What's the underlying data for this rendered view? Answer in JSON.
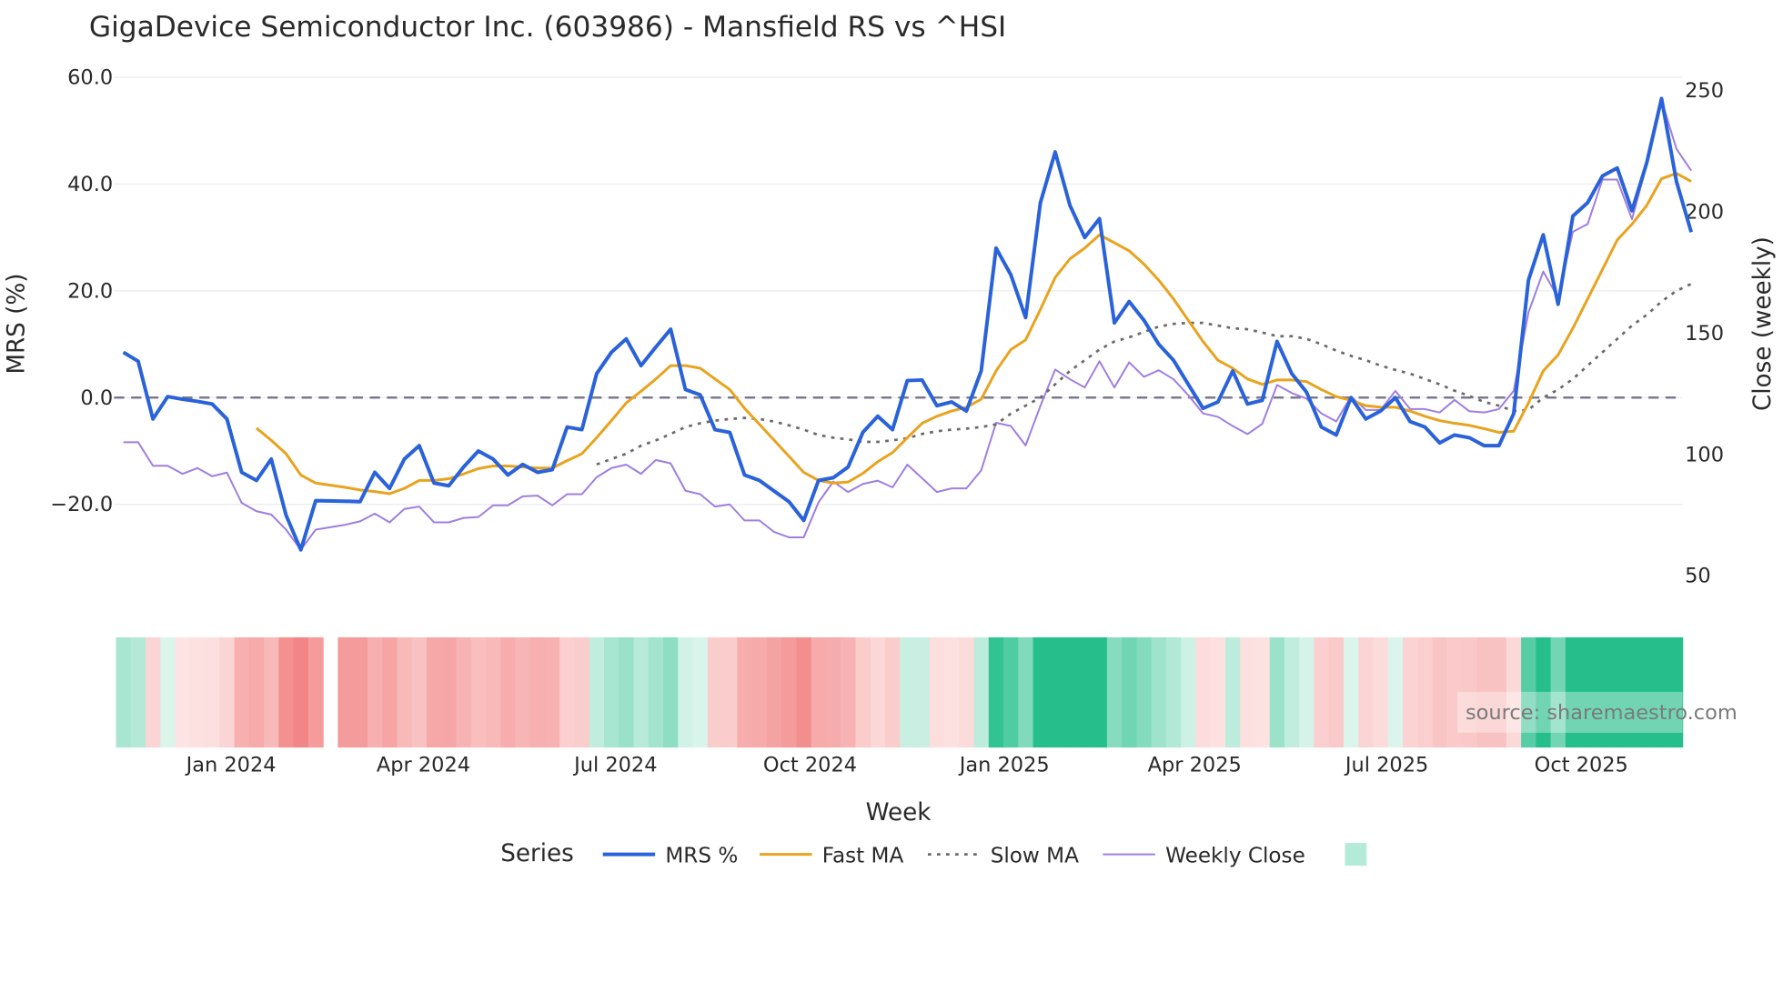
{
  "chart_data": {
    "type": "line",
    "title": "GigaDevice Semiconductor Inc. (603986) - Mansfield RS vs ^HSI",
    "xlabel": "Week",
    "ylabel": "MRS (%)",
    "y2label": "Close (weekly)",
    "ylim": [
      -31,
      62
    ],
    "y2lim": [
      50,
      258
    ],
    "yticks": [
      "60.0",
      "40.0",
      "20.0",
      "0.0",
      "−20.0"
    ],
    "ytick_values": [
      60,
      40,
      20,
      0,
      -20
    ],
    "y2ticks": [
      "250",
      "200",
      "150",
      "100",
      "50"
    ],
    "y2tick_values": [
      250,
      200,
      150,
      100,
      50
    ],
    "xticks": [
      "Jan 2024",
      "Apr 2024",
      "Jul 2024",
      "Oct 2024",
      "Jan 2025",
      "Apr 2025",
      "Jul 2025",
      "Oct 2025"
    ],
    "xtick_dates": [
      "2024-01-01",
      "2024-04-01",
      "2024-07-01",
      "2024-10-01",
      "2025-01-01",
      "2025-04-01",
      "2025-07-01",
      "2025-10-01"
    ],
    "x_start": "2023-11-11",
    "x_frequency": "weekly",
    "missing_week_index": 14,
    "zero_line": 0,
    "grid": true,
    "legend_title": "Series",
    "legend_position": "bottom",
    "series": [
      {
        "name": "MRS %",
        "axis": "left",
        "color": "#2a62d9",
        "values": [
          8.5,
          6.8,
          -4,
          0.2,
          -0.3,
          -0.7,
          -1.2,
          -4,
          -14,
          -15.5,
          -11.5,
          -22,
          -28.5,
          -19.3,
          -19.4,
          -19.5,
          -14,
          -17,
          -11.5,
          -9,
          -16,
          -16.5,
          -13,
          -10,
          -11.5,
          -14.5,
          -12.5,
          -14,
          -13.5,
          -5.5,
          -6,
          4.5,
          8.5,
          11,
          6,
          9.5,
          12.8,
          1.5,
          0.5,
          -6,
          -6.5,
          -14.5,
          -15.5,
          -17.5,
          -19.5,
          -23,
          -15.5,
          -15,
          -13,
          -6.5,
          -3.5,
          -6,
          3.2,
          3.3,
          -1.5,
          -0.8,
          -2.5,
          5,
          28,
          23,
          15,
          36.5,
          46,
          36,
          30,
          33.5,
          14,
          18,
          14.5,
          10,
          7,
          2.5,
          -2,
          -0.8,
          5,
          -1.2,
          -0.5,
          10.5,
          4.5,
          1,
          -5.5,
          -7,
          0,
          -4,
          -2.5,
          0,
          -4.5,
          -5.5,
          -8.5,
          -7,
          -7.5,
          -9,
          -9,
          -3,
          22,
          30.5,
          17.5,
          34,
          36.5,
          41.5,
          43,
          35,
          44,
          56,
          40.5,
          31
        ]
      },
      {
        "name": "Fast MA",
        "axis": "left",
        "color": "#e8a31f",
        "values": [
          -5.7,
          -8,
          -10.5,
          -14.5,
          -16,
          -16.8,
          -17.3,
          -17.6,
          -18,
          -17,
          -15.5,
          -15.5,
          -15.2,
          -14.3,
          -13.3,
          -12.8,
          -12.8,
          -13,
          -13.2,
          -13.2,
          -11.8,
          -10.5,
          -7.5,
          -4.3,
          -1,
          1.2,
          3.5,
          6,
          6,
          5.5,
          3.5,
          1.5,
          -2,
          -5,
          -8,
          -11,
          -14,
          -15.5,
          -16,
          -15.8,
          -14.2,
          -12,
          -10.3,
          -7.5,
          -4.8,
          -3.5,
          -2.5,
          -1.8,
          -0.3,
          5,
          9,
          10.8,
          16.5,
          22.5,
          26,
          28,
          30.5,
          29,
          27.5,
          25,
          22,
          18.5,
          14.5,
          10.5,
          7,
          5.5,
          3.5,
          2.5,
          3.3,
          3.3,
          3,
          1.5,
          0.2,
          -0.5,
          -1.5,
          -1.8,
          -1.8,
          -2.5,
          -3.5,
          -4.3,
          -4.8,
          -5.2,
          -5.8,
          -6.5,
          -6.3,
          -1,
          5,
          8,
          13,
          18.5,
          24,
          29.5,
          32.5,
          36,
          41,
          42,
          40.5
        ]
      },
      {
        "name": "Slow MA",
        "axis": "left",
        "color": "#6b6b6b",
        "values": [
          -12.5,
          -11.5,
          -10.5,
          -9,
          -8,
          -6.8,
          -5.5,
          -4.8,
          -4.3,
          -4,
          -3.8,
          -4,
          -4.5,
          -5.2,
          -6,
          -7,
          -7.5,
          -7.8,
          -8.3,
          -8.3,
          -8,
          -7.6,
          -6.8,
          -6.3,
          -6,
          -5.8,
          -5.5,
          -5,
          -3,
          -1.5,
          0,
          2.5,
          5,
          7,
          9,
          10.5,
          11.3,
          12.3,
          13.3,
          13.8,
          14,
          14,
          13.5,
          13,
          12.8,
          12.2,
          11.5,
          11.5,
          11,
          10,
          8.8,
          7.8,
          7,
          6,
          5.2,
          4.5,
          3.5,
          2.5,
          1.3,
          0.3,
          -0.8,
          -1.5,
          -2.5,
          -2.3,
          0,
          1.5,
          3.5,
          6,
          8.5,
          11,
          13.5,
          15.5,
          18,
          20,
          21.3
        ]
      },
      {
        "name": "Weekly Close",
        "axis": "right",
        "color": "#a07ee0",
        "values": [
          105,
          105,
          95.3,
          95.3,
          92,
          94.4,
          91,
          92.5,
          80,
          76.6,
          75.2,
          69,
          60.7,
          69,
          71,
          72.4,
          75.6,
          72,
          77.5,
          78.5,
          72,
          72,
          73.8,
          74.2,
          79,
          79,
          82.7,
          83,
          79,
          83.6,
          83.6,
          90.6,
          94.4,
          95.8,
          92,
          97.7,
          96.3,
          85,
          83.6,
          78.5,
          79.4,
          72.8,
          72.8,
          68,
          65.8,
          65.8,
          80.3,
          88.8,
          84.5,
          87.8,
          89.2,
          86.4,
          95.8,
          90.2,
          84.5,
          86,
          86,
          93.4,
          113,
          111.7,
          103.7,
          120,
          135,
          131,
          127.6,
          138.4,
          127.6,
          138,
          132,
          134.7,
          131,
          124.4,
          116.9,
          115.5,
          111.7,
          108.4,
          112.6,
          128.6,
          125.3,
          123,
          116.9,
          113.6,
          123.9,
          118.3,
          118.3,
          126.2,
          118.7,
          118.7,
          117.3,
          122.5,
          117.8,
          117.3,
          118.7,
          126.2,
          158.5,
          175.4,
          164.6,
          191.8,
          195,
          213.3,
          213.3,
          197,
          219.4,
          246,
          226,
          217
        ]
      }
    ],
    "heatmap": {
      "name": "",
      "source_series": "MRS %",
      "positive_color": "#26bf8c",
      "negative_color": "#f28686",
      "legend_color": "#b3ead8"
    },
    "watermark": "source: sharemaestro.com"
  }
}
